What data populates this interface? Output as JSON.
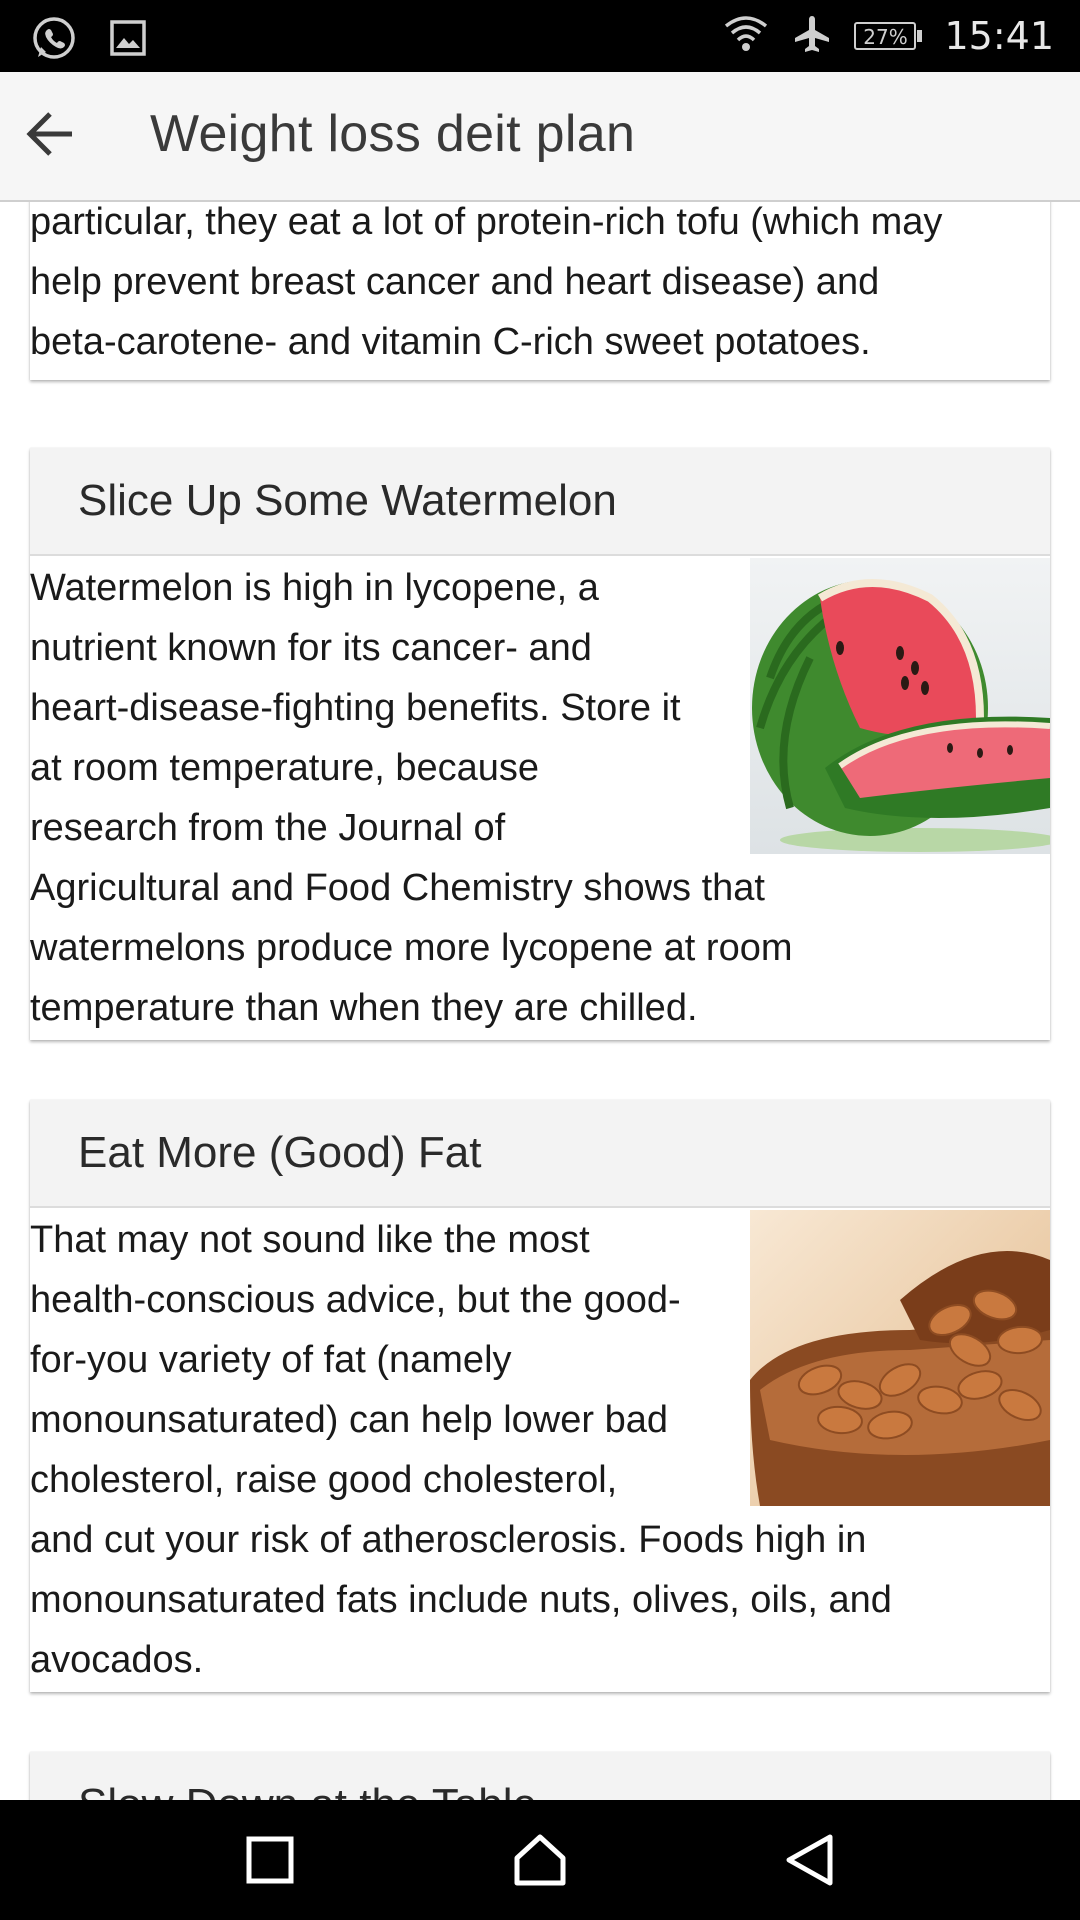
{
  "status_bar": {
    "left_icons": [
      "whatsapp-icon",
      "image-icon"
    ],
    "right_icons": [
      "wifi-icon",
      "airplane-mode-icon"
    ],
    "battery_percent": "27%",
    "battery_level": 0.27,
    "time": "15:41"
  },
  "app_bar": {
    "title": "Weight loss deit plan",
    "back_icon": "arrow-left-icon"
  },
  "cards": [
    {
      "title": "",
      "lines": [
        "particular, they eat a lot of protein-rich tofu (which may",
        "help prevent breast cancer and heart disease) and",
        "beta-carotene- and vitamin C-rich sweet potatoes."
      ]
    },
    {
      "title": "Slice Up Some Watermelon",
      "image": "watermelon-image",
      "lines": [
        "Watermelon is high in lycopene, a",
        "nutrient known for its cancer- and",
        "heart-disease-fighting benefits. Store it",
        "at room temperature, because",
        "research from the Journal of",
        "Agricultural and Food Chemistry shows that",
        "watermelons produce more lycopene at room",
        "temperature than when they are chilled."
      ]
    },
    {
      "title": "Eat More (Good) Fat",
      "image": "almonds-image",
      "lines": [
        "That may not sound like the most",
        "health-conscious advice, but the good-",
        "for-you variety of fat (namely",
        "monounsaturated) can help lower bad",
        "cholesterol, raise good cholesterol,",
        "and cut your risk of atherosclerosis. Foods high in",
        "monounsaturated fats include nuts, olives, oils, and",
        "avocados."
      ]
    },
    {
      "title": "Slow Down at the Table"
    }
  ],
  "nav_bar": {
    "recents_icon": "square-icon",
    "home_icon": "home-icon",
    "back_icon": "triangle-back-icon"
  }
}
